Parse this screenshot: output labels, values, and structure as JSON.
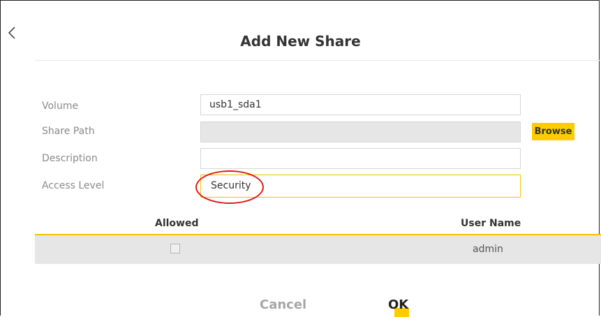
{
  "dialog": {
    "title": "Add New Share",
    "back_icon": "chevron-left-icon"
  },
  "form": {
    "volume": {
      "label": "Volume",
      "value": "usb1_sda1"
    },
    "share_path": {
      "label": "Share Path",
      "value": "",
      "button_label": "Browse"
    },
    "description": {
      "label": "Description",
      "value": ""
    },
    "access_level": {
      "label": "Access Level",
      "value": "Security"
    }
  },
  "table": {
    "columns": [
      "Allowed",
      "User Name"
    ],
    "rows": [
      {
        "allowed": false,
        "user_name": "admin"
      }
    ]
  },
  "footer": {
    "cancel_label": "Cancel",
    "ok_label": "OK"
  },
  "colors": {
    "accent": "#ffcc00",
    "highlight": "#e01818"
  }
}
